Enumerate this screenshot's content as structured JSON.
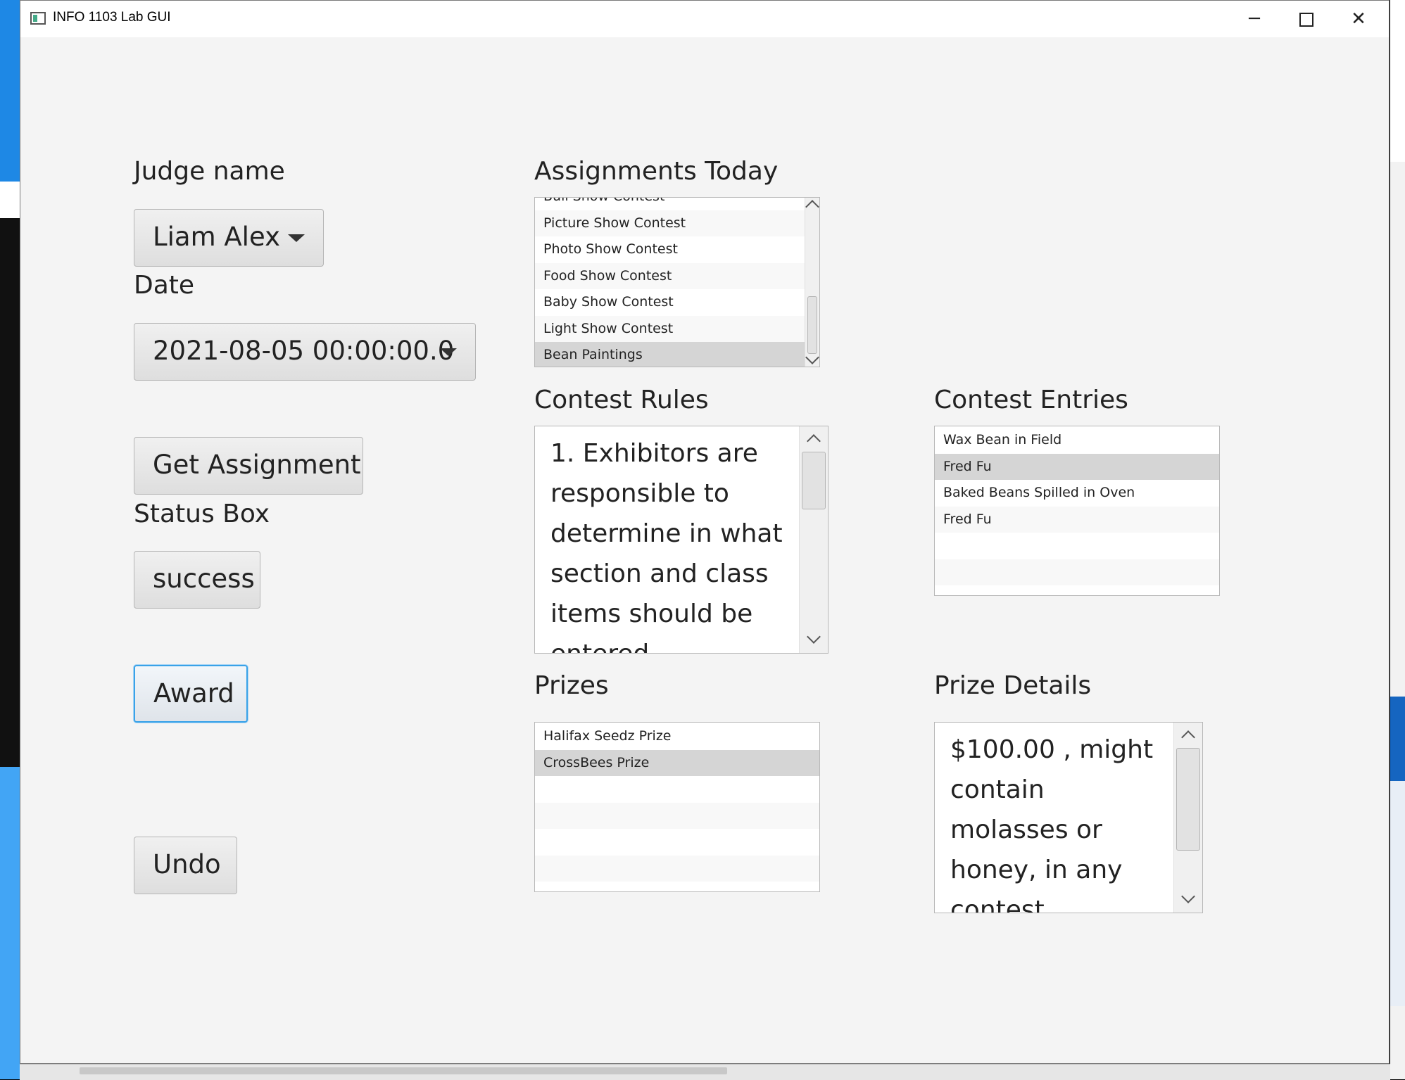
{
  "window": {
    "title": "INFO 1103 Lab GUI",
    "minimize_glyph": "─",
    "close_glyph": "✕"
  },
  "labels": {
    "judge_name": "Judge name",
    "date": "Date",
    "status_box": "Status Box",
    "assignments_today": "Assignments Today",
    "contest_rules": "Contest Rules",
    "contest_entries": "Contest Entries",
    "prizes": "Prizes",
    "prize_details": "Prize Details"
  },
  "judge_select": {
    "value": "Liam Alex"
  },
  "date_select": {
    "value": "2021-08-05 00:00:00.0"
  },
  "buttons": {
    "get_assignment": "Get Assignment",
    "status": "success",
    "award": "Award",
    "undo": "Undo"
  },
  "assignments": [
    {
      "label": "Bull Show Contest",
      "selected": false
    },
    {
      "label": "Picture Show Contest",
      "selected": false
    },
    {
      "label": "Photo Show Contest",
      "selected": false
    },
    {
      "label": "Food Show Contest",
      "selected": false
    },
    {
      "label": "Baby Show Contest",
      "selected": false
    },
    {
      "label": "Light Show Contest",
      "selected": false
    },
    {
      "label": "Bean Paintings",
      "selected": true
    }
  ],
  "contest_rules_text": "1. Exhibitors are responsible to determine in what section and class items should be entered.",
  "contest_entries": [
    {
      "label": "Wax Bean in Field",
      "selected": false
    },
    {
      "label": "Fred Fu",
      "selected": true
    },
    {
      "label": "Baked Beans Spilled in Oven",
      "selected": false
    },
    {
      "label": "Fred Fu",
      "selected": false
    }
  ],
  "prizes": [
    {
      "label": "Halifax Seedz Prize",
      "selected": false
    },
    {
      "label": "CrossBees Prize",
      "selected": true
    }
  ],
  "prize_details_text": "$100.00 , might contain molasses or honey, in any contest"
}
